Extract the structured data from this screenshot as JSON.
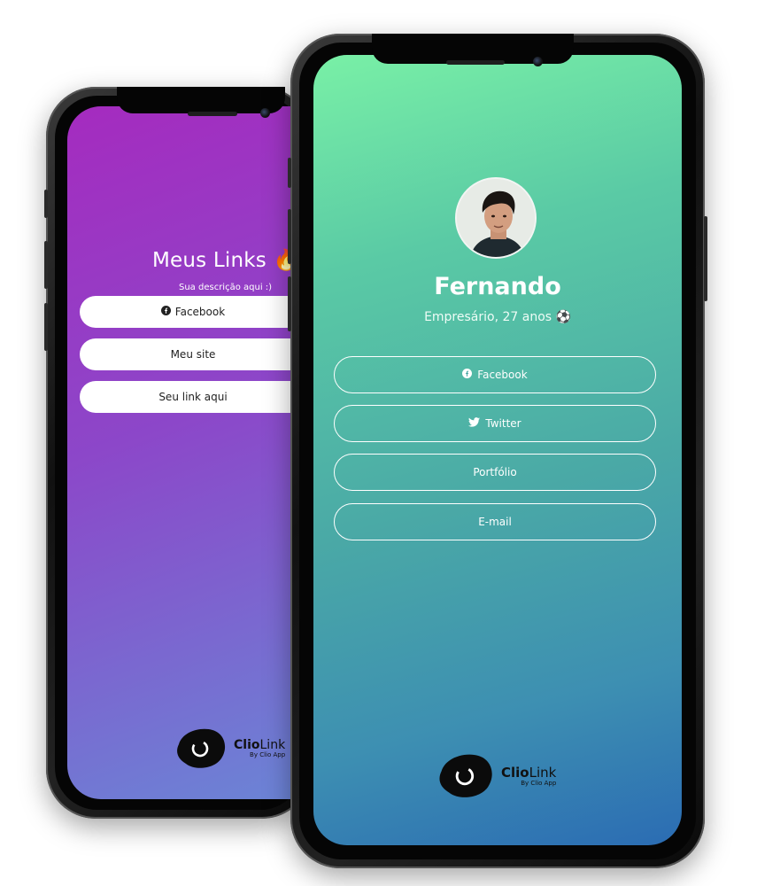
{
  "back_phone": {
    "title": "Meus Links 🔥",
    "description": "Sua descrição aqui :)",
    "links": [
      {
        "label": "Facebook",
        "icon": "facebook-icon"
      },
      {
        "label": "Meu site"
      },
      {
        "label": "Seu link aqui"
      }
    ],
    "logo": {
      "name_bold": "Clio",
      "name_light": "Link",
      "tagline": "By Clio App"
    }
  },
  "front_phone": {
    "name": "Fernando",
    "description": "Empresário, 27 anos ⚽",
    "links": [
      {
        "label": "Facebook",
        "icon": "facebook-icon"
      },
      {
        "label": "Twitter",
        "icon": "twitter-icon"
      },
      {
        "label": "Portfólio"
      },
      {
        "label": "E-mail"
      }
    ],
    "logo": {
      "name_bold": "Clio",
      "name_light": "Link",
      "tagline": "By Clio App"
    }
  },
  "colors": {
    "back_gradient_start": "#a52bbf",
    "back_gradient_end": "#6a86d6",
    "front_gradient_start": "#79f0a6",
    "front_gradient_end": "#2b6cb3"
  }
}
